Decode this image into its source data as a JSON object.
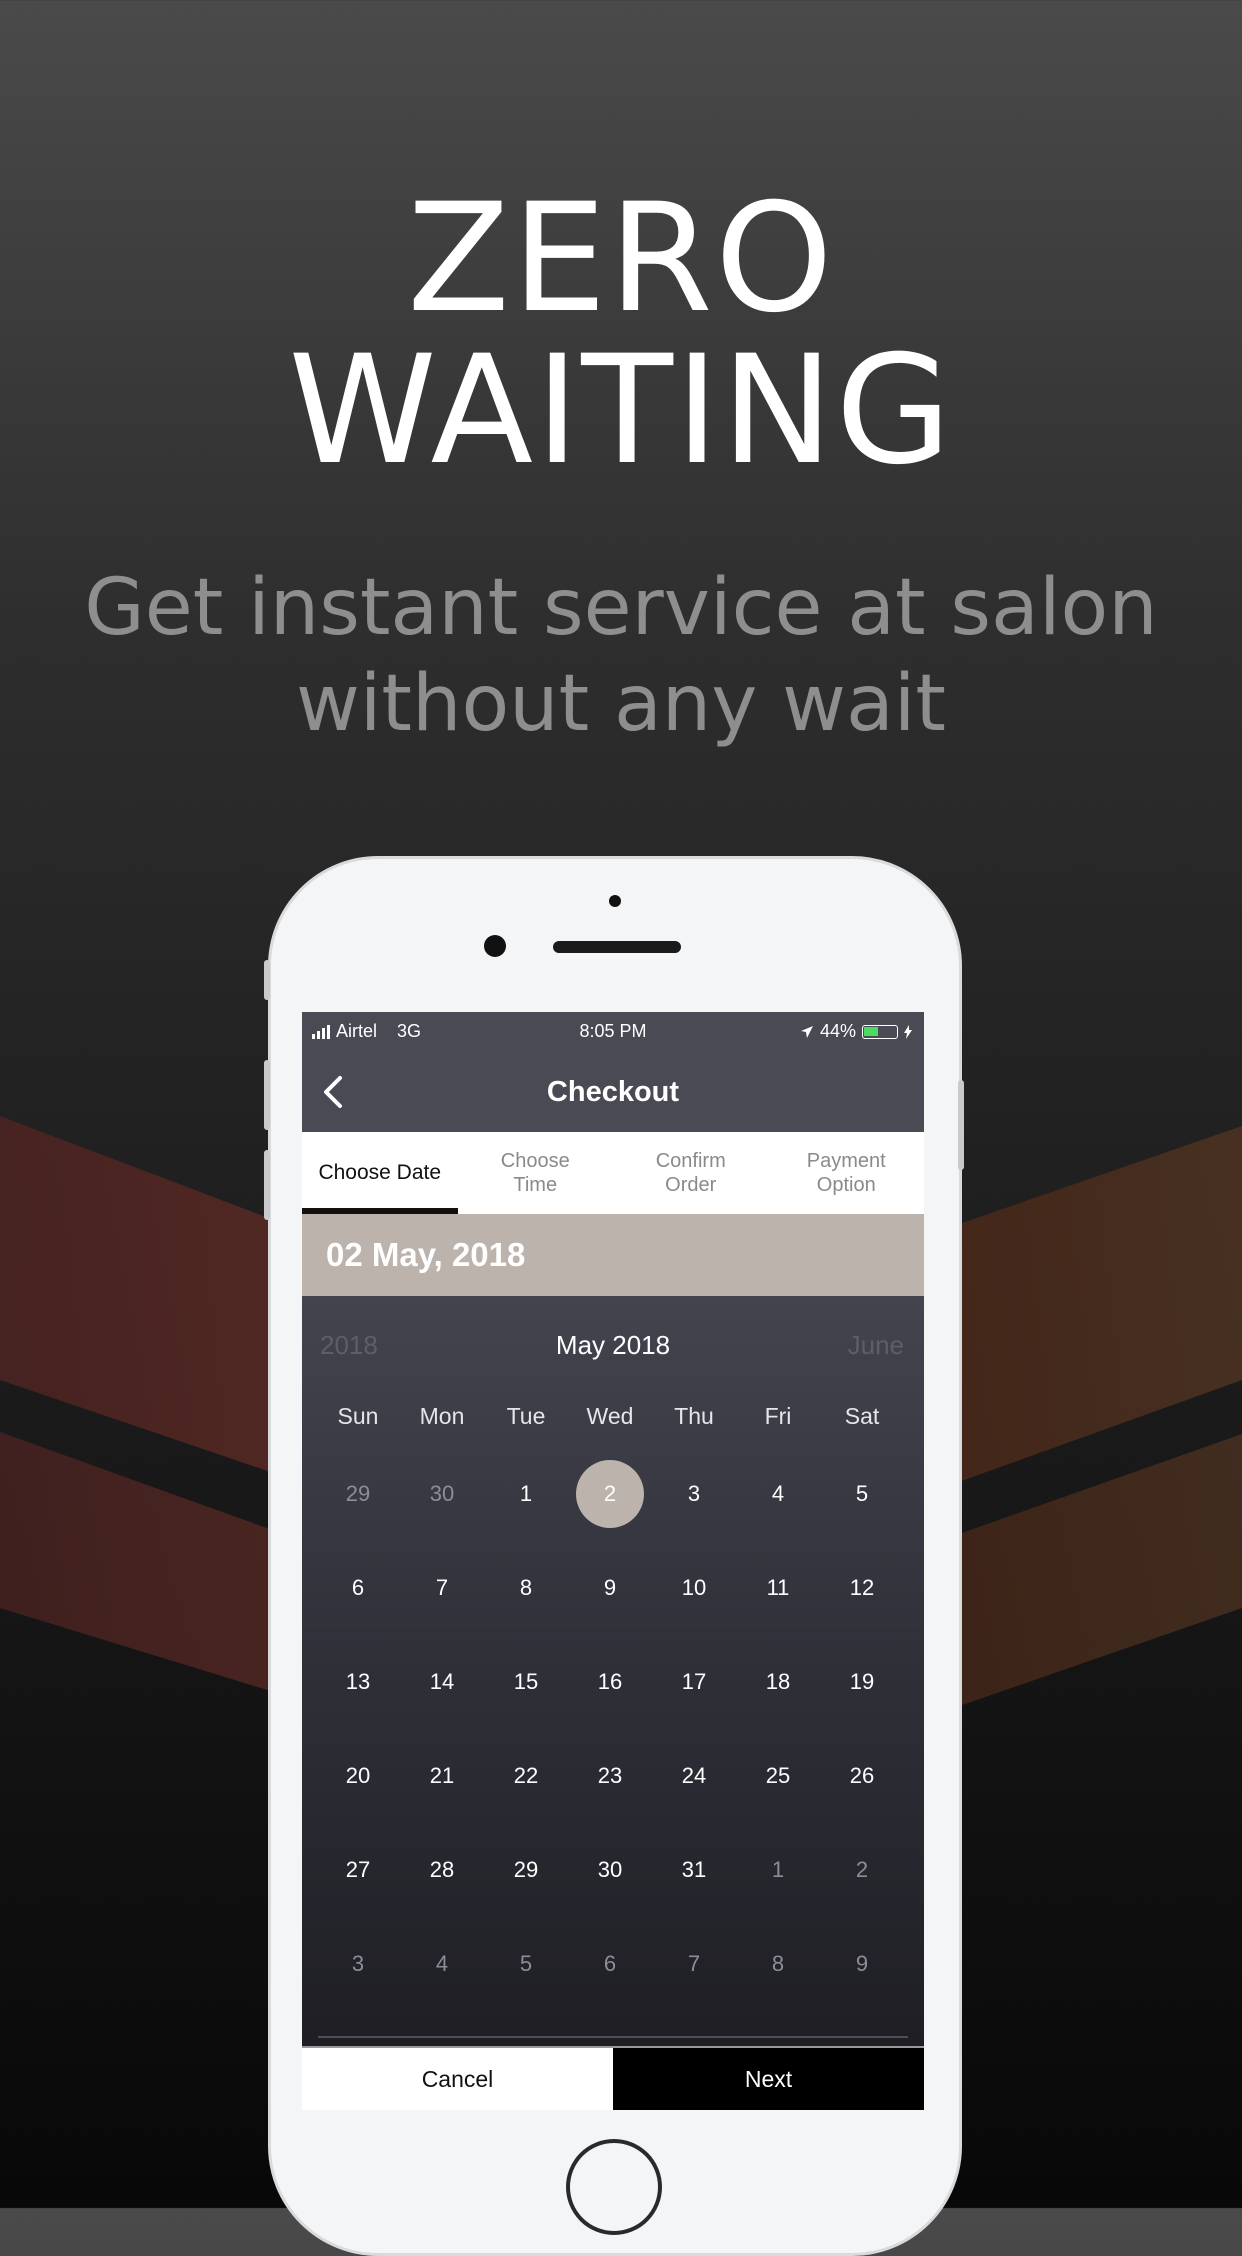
{
  "headline": {
    "line1": "ZERO",
    "line2": "WAITING"
  },
  "subtitle": {
    "line1": "Get instant service at salon",
    "line2": "without any wait"
  },
  "status_bar": {
    "carrier": "Airtel",
    "network": "3G",
    "time": "8:05 PM",
    "battery": "44%"
  },
  "header": {
    "title": "Checkout"
  },
  "tabs": [
    {
      "label": "Choose Date",
      "active": true
    },
    {
      "label": "Choose\nTime",
      "active": false
    },
    {
      "label": "Confirm\nOrder",
      "active": false
    },
    {
      "label": "Payment\nOption",
      "active": false
    }
  ],
  "selected_date": "02 May, 2018",
  "calendar": {
    "prev_label": "2018",
    "month_label": "May 2018",
    "next_label": "June",
    "weekdays": [
      "Sun",
      "Mon",
      "Tue",
      "Wed",
      "Thu",
      "Fri",
      "Sat"
    ],
    "weeks": [
      [
        "29",
        "30",
        "1",
        "2",
        "3",
        "4",
        "5"
      ],
      [
        "6",
        "7",
        "8",
        "9",
        "10",
        "11",
        "12"
      ],
      [
        "13",
        "14",
        "15",
        "16",
        "17",
        "18",
        "19"
      ],
      [
        "20",
        "21",
        "22",
        "23",
        "24",
        "25",
        "26"
      ],
      [
        "27",
        "28",
        "29",
        "30",
        "31",
        "1",
        "2"
      ],
      [
        "3",
        "4",
        "5",
        "6",
        "7",
        "8",
        "9"
      ]
    ],
    "selected_day": "2"
  },
  "buttons": {
    "cancel": "Cancel",
    "next": "Next"
  },
  "colors": {
    "accent": "#bcb3ad",
    "header_bg": "#4a4a55",
    "chevron_red": "#5a2a24",
    "chevron_orange": "#4e3322"
  }
}
